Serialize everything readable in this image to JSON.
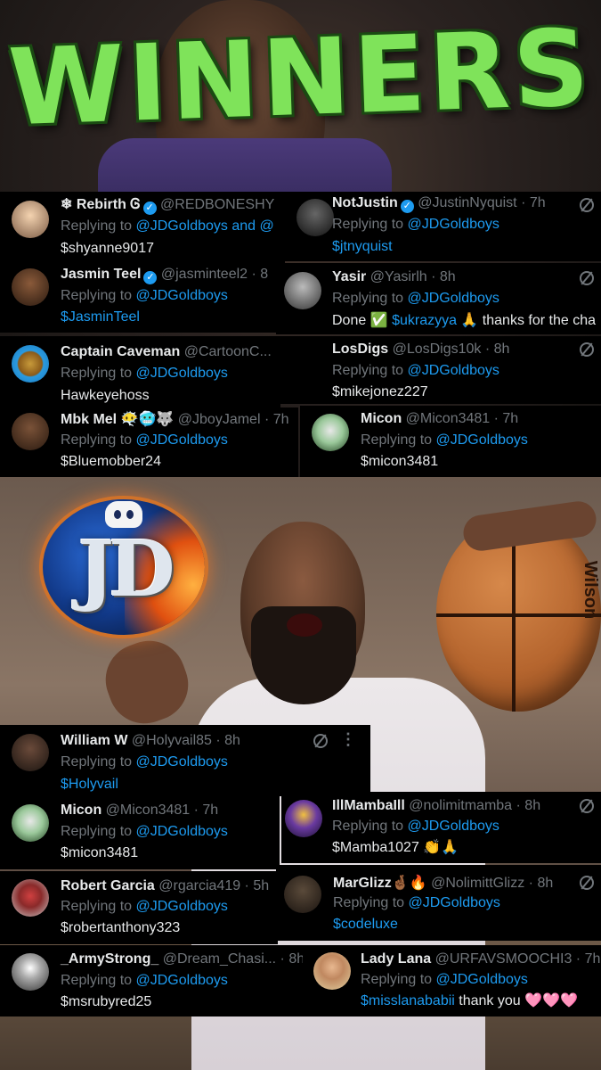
{
  "title": "WINNERS",
  "logo": {
    "text": "JD"
  },
  "basketball_brand": "Wilson",
  "common": {
    "replying_prefix": "Replying to "
  },
  "tweets": [
    {
      "name": "❄ Rebirth Ꮆ",
      "verified": true,
      "handle": "@REDBONESHY",
      "time": "",
      "replying_to": "@JDGoldboys and @",
      "content": "$shyanne9017",
      "content_is_link": false
    },
    {
      "name": "NotJustin",
      "verified": true,
      "handle": "@JustinNyquist",
      "time": " · 7h",
      "replying_to": "@JDGoldboys",
      "content": "$jtnyquist",
      "content_is_link": true
    },
    {
      "name": "Jasmin Teel",
      "verified": true,
      "handle": "@jasminteel2",
      "time": " · 8",
      "replying_to": "@JDGoldboys",
      "content": "$JasminTeel",
      "content_is_link": true
    },
    {
      "name": "Yasir",
      "verified": false,
      "handle": "@Yasirlh",
      "time": " · 8h",
      "replying_to": "@JDGoldboys",
      "content_pre": "Done ✅ ",
      "content_link": "$ukrazyya",
      "content_post": " 🙏 thanks for the cha"
    },
    {
      "name": "Captain Caveman",
      "verified": false,
      "handle": "@CartoonC...",
      "time": "",
      "replying_to": "@JDGoldboys",
      "content": "Hawkeyehoss",
      "content_is_link": false
    },
    {
      "name": "LosDigs",
      "verified": false,
      "handle": "@LosDigs10k",
      "time": " · 8h",
      "replying_to": "@JDGoldboys",
      "content": "$mikejonez227",
      "content_is_link": false
    },
    {
      "name": "Mbk Mel 😶‍🌫️🥶🐺",
      "verified": false,
      "handle": "@JboyJamel",
      "time": " · 7h",
      "replying_to": "@JDGoldboys",
      "content": "$Bluemobber24",
      "content_is_link": false
    },
    {
      "name": "Micon",
      "verified": false,
      "handle": "@Micon3481",
      "time": " · 7h",
      "replying_to": "@JDGoldboys",
      "content": "$micon3481",
      "content_is_link": false
    },
    {
      "name": "William W",
      "verified": false,
      "handle": "@Holyvail85",
      "time": " · 8h",
      "replying_to": "@JDGoldboys",
      "content": "$Holyvail",
      "content_is_link": true
    },
    {
      "name": "Micon",
      "verified": false,
      "handle": "@Micon3481",
      "time": " · 7h",
      "replying_to": "@JDGoldboys",
      "content": "$micon3481",
      "content_is_link": false
    },
    {
      "name": "IllMambaIll",
      "verified": false,
      "handle": "@nolimitmamba",
      "time": " · 8h",
      "replying_to": "@JDGoldboys",
      "content": "$Mamba1027 👏🙏",
      "content_is_link": false
    },
    {
      "name": "Robert Garcia",
      "verified": false,
      "handle": "@rgarcia419",
      "time": " · 5h",
      "replying_to": "@JDGoldboys",
      "content": "$robertanthony323",
      "content_is_link": false
    },
    {
      "name": "MarGlizz🤞🏾🔥",
      "verified": false,
      "handle": "@NolimittGlizz",
      "time": " · 8h",
      "replying_to": "@JDGoldboys",
      "content": "$codeluxe",
      "content_is_link": true
    },
    {
      "name": "_ArmyStrong_",
      "verified": false,
      "handle": "@Dream_Chasi...",
      "time": " · 8h",
      "replying_to": "@JDGoldboys",
      "content": "$msrubyred25",
      "content_is_link": false
    },
    {
      "name": "Lady Lana",
      "verified": false,
      "handle": "@URFAVSMOOCHI3",
      "time": " · 7h",
      "replying_to": "@JDGoldboys",
      "content_link": "$misslanababii",
      "content_post": " thank you 🩷🩷🩷"
    }
  ],
  "colors": {
    "title_green": "#7fe35a",
    "link_blue": "#1d9bf0",
    "muted": "#71767b"
  },
  "icons": [
    "nobot-icon",
    "more-icon",
    "verified-icon",
    "discord-icon"
  ]
}
